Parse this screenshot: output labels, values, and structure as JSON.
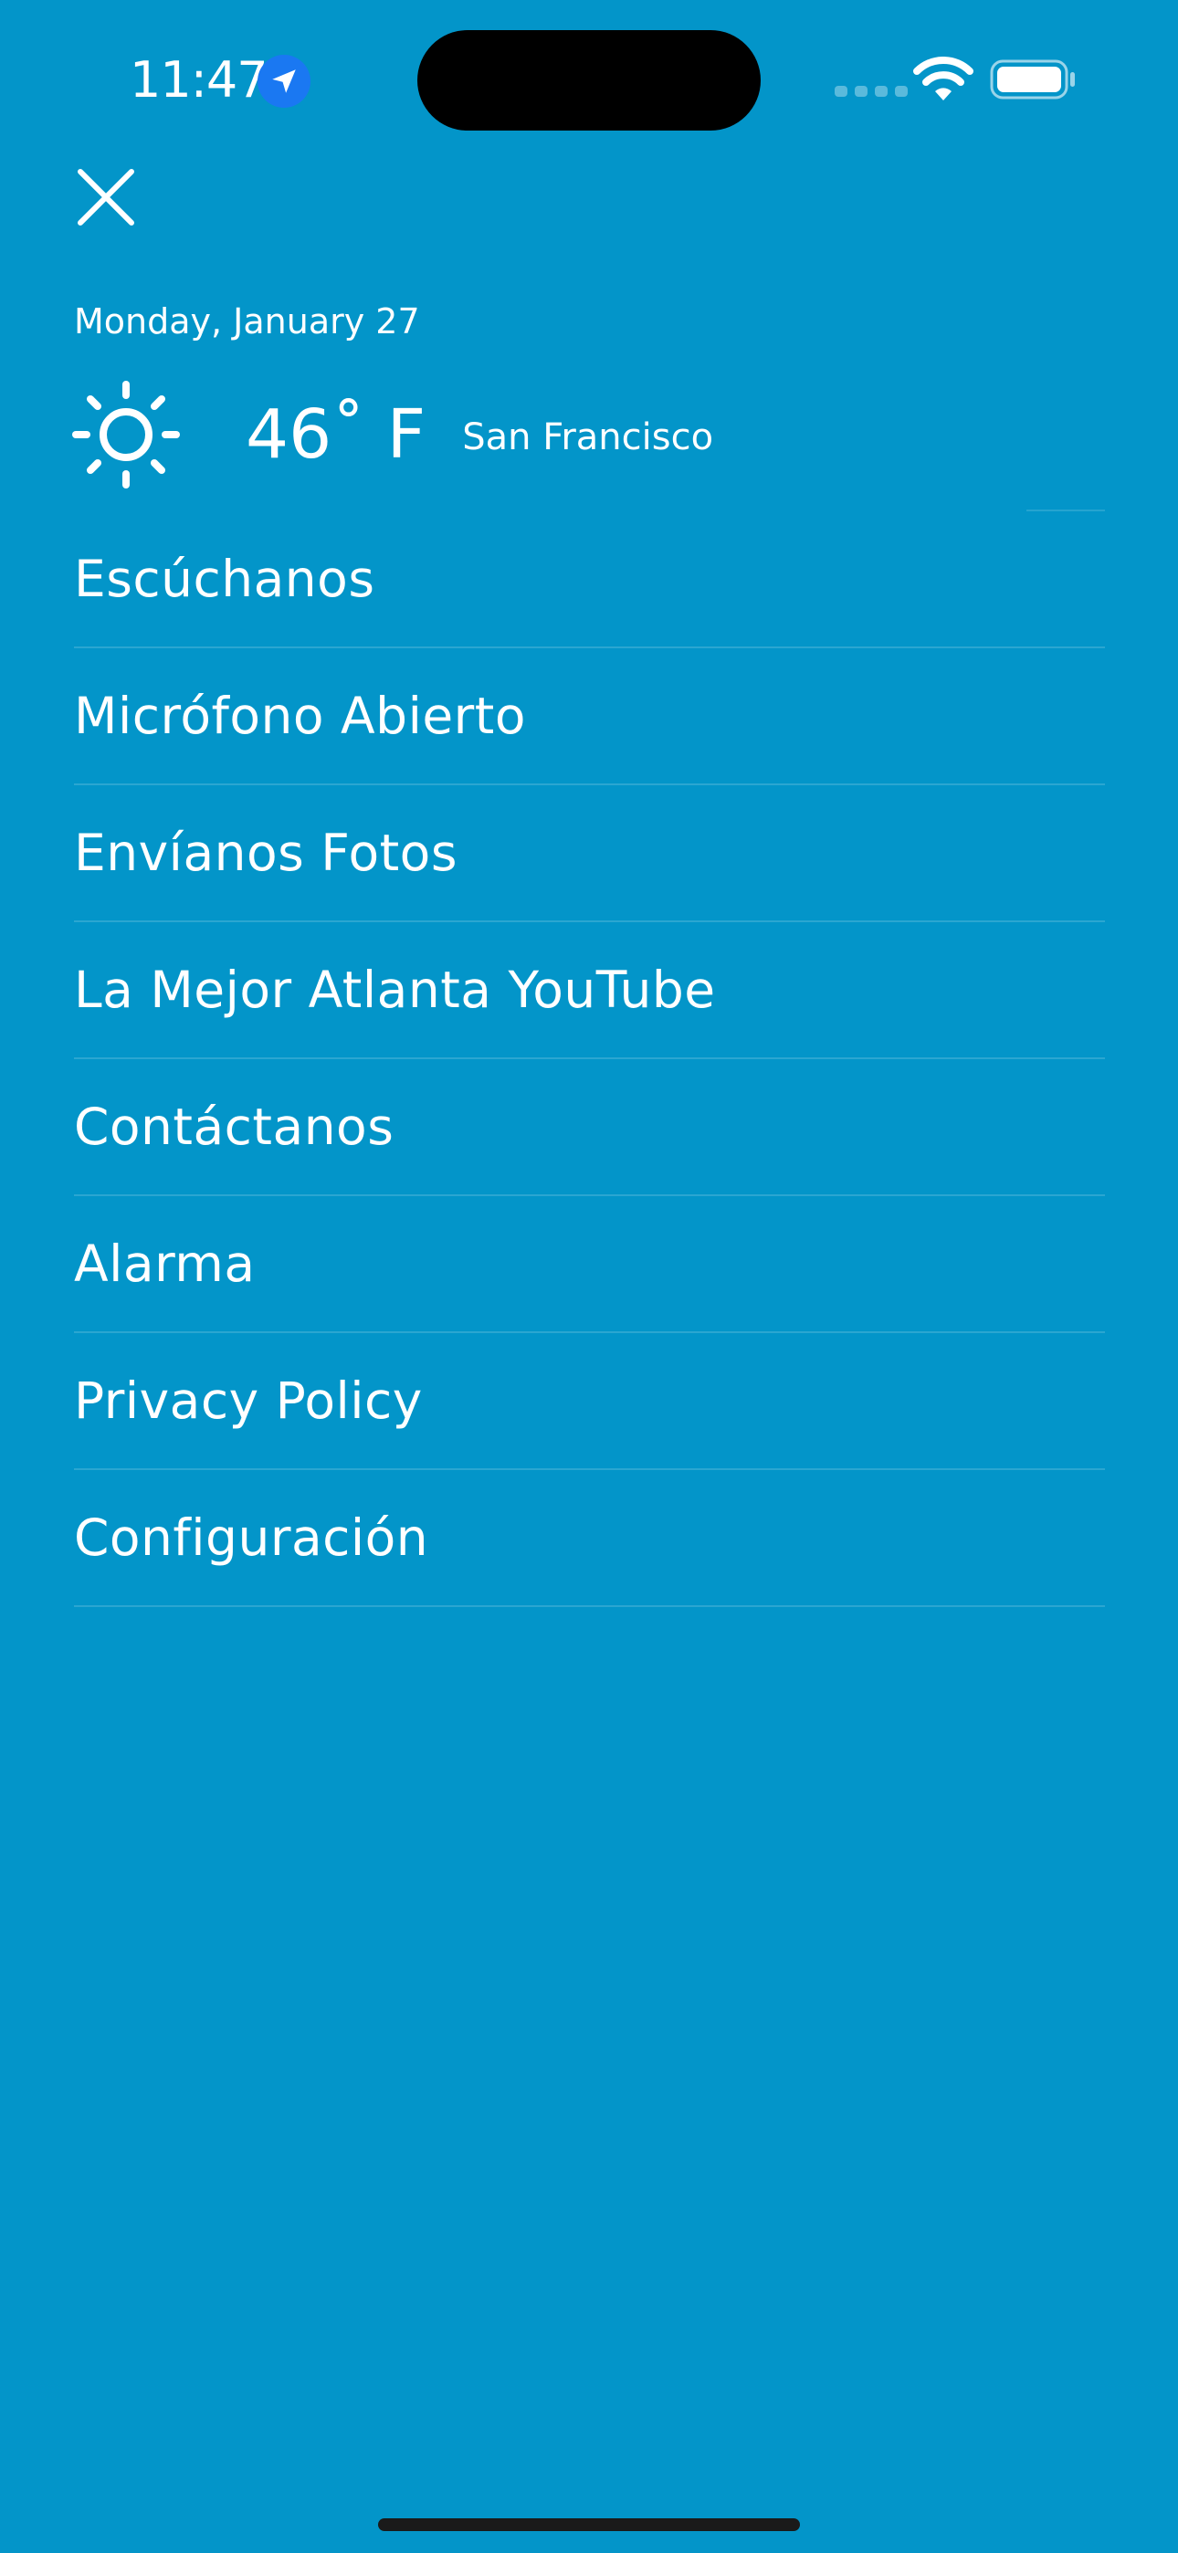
{
  "status_bar": {
    "time": "11:47",
    "icons": [
      "location-arrow-icon",
      "cellular-signal-icon",
      "wifi-icon",
      "battery-icon"
    ]
  },
  "theme": {
    "background": "#0395c9",
    "text": "#ffffff",
    "location_badge": "#1a78f2"
  },
  "header": {
    "close_icon": "close-icon",
    "date": "Monday, January 27",
    "weather": {
      "icon": "sun-icon",
      "temperature": "46˚ F",
      "city": "San Francisco"
    }
  },
  "menu": {
    "items": [
      {
        "label": "Escúchanos"
      },
      {
        "label": "Micrófono Abierto"
      },
      {
        "label": "Envíanos Fotos"
      },
      {
        "label": "La Mejor Atlanta YouTube"
      },
      {
        "label": "Contáctanos"
      },
      {
        "label": "Alarma"
      },
      {
        "label": "Privacy Policy"
      },
      {
        "label": "Configuración"
      }
    ]
  }
}
